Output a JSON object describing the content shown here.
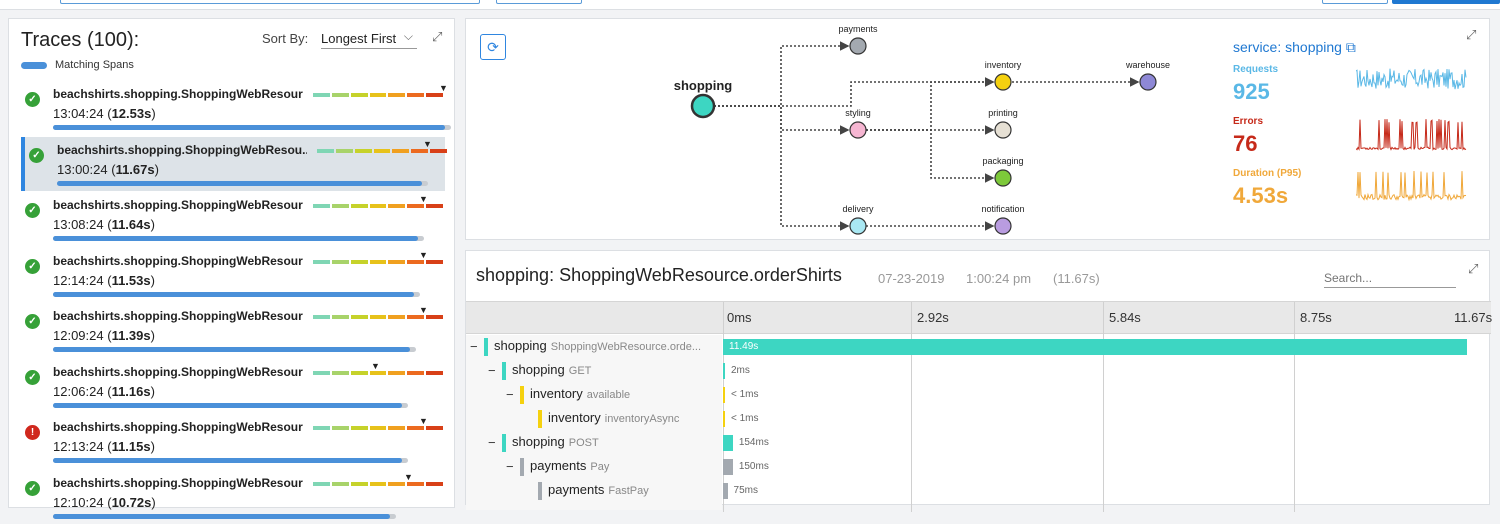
{
  "traces_panel": {
    "title": "Traces (100):",
    "sort_label": "Sort By:",
    "sort_value": "Longest First",
    "legend_label": "Matching Spans",
    "heat_colors": [
      "#7fd6b4",
      "#a8d36a",
      "#c6d22a",
      "#e7c21a",
      "#f0a020",
      "#ec6a20",
      "#d84018"
    ],
    "traces": [
      {
        "name": "beachshirts.shopping.ShoppingWebResource...",
        "time": "13:04:24",
        "duration": "12.53s",
        "status": "ok",
        "fraction": 1.0
      },
      {
        "name": "beachshirts.shopping.ShoppingWebResou...",
        "time": "13:00:24",
        "duration": "11.67s",
        "status": "ok",
        "fraction": 0.93,
        "selected": true
      },
      {
        "name": "beachshirts.shopping.ShoppingWebResource...",
        "time": "13:08:24",
        "duration": "11.64s",
        "status": "ok",
        "fraction": 0.93
      },
      {
        "name": "beachshirts.shopping.ShoppingWebResource...",
        "time": "12:14:24",
        "duration": "11.53s",
        "status": "ok",
        "fraction": 0.92
      },
      {
        "name": "beachshirts.shopping.ShoppingWebResource...",
        "time": "12:09:24",
        "duration": "11.39s",
        "status": "ok",
        "fraction": 0.91
      },
      {
        "name": "beachshirts.shopping.ShoppingWebResource...",
        "time": "12:06:24",
        "duration": "11.16s",
        "status": "ok",
        "fraction": 0.89
      },
      {
        "name": "beachshirts.shopping.ShoppingWebResource...",
        "time": "12:13:24",
        "duration": "11.15s",
        "status": "error",
        "fraction": 0.89
      },
      {
        "name": "beachshirts.shopping.ShoppingWebResource...",
        "time": "12:10:24",
        "duration": "10.72s",
        "status": "ok",
        "fraction": 0.86
      }
    ]
  },
  "service_map": {
    "nodes": [
      {
        "id": "shopping",
        "label": "shopping",
        "color": "#3dd6c2",
        "root": true
      },
      {
        "id": "payments",
        "label": "payments",
        "color": "#a3a9b0"
      },
      {
        "id": "styling",
        "label": "styling",
        "color": "#f6b6d2"
      },
      {
        "id": "delivery",
        "label": "delivery",
        "color": "#a9e8f3"
      },
      {
        "id": "inventory",
        "label": "inventory",
        "color": "#f5d10f"
      },
      {
        "id": "printing",
        "label": "printing",
        "color": "#e6e0d4"
      },
      {
        "id": "packaging",
        "label": "packaging",
        "color": "#7dc93a"
      },
      {
        "id": "notification",
        "label": "notification",
        "color": "#b99ce0"
      },
      {
        "id": "warehouse",
        "label": "warehouse",
        "color": "#8e88d6"
      }
    ],
    "service": {
      "title": "service: shopping",
      "requests_label": "Requests",
      "requests_value": "925",
      "requests_color": "#5ab8e6",
      "errors_label": "Errors",
      "errors_value": "76",
      "errors_color": "#c62a1a",
      "duration_label": "Duration (P95)",
      "duration_value": "4.53s",
      "duration_color": "#f0a83a"
    }
  },
  "trace_detail": {
    "title": "shopping: ShoppingWebResource.orderShirts",
    "date": "07-23-2019",
    "time": "1:00:24 pm",
    "duration": "(11.67s)",
    "search_placeholder": "Search...",
    "ticks": [
      "0ms",
      "2.92s",
      "5.84s",
      "8.75s",
      "11.67s"
    ],
    "spans": [
      {
        "service": "shopping",
        "operation": "ShoppingWebResource.orde...",
        "depth": 0,
        "color": "#3dd6c2",
        "duration_label": "11.49s",
        "fraction": 0.985
      },
      {
        "service": "shopping",
        "operation": "GET",
        "depth": 1,
        "color": "#3dd6c2",
        "duration_label": "2ms",
        "fraction": 0.002
      },
      {
        "service": "inventory",
        "operation": "available",
        "depth": 2,
        "color": "#f5d10f",
        "duration_label": "< 1ms",
        "fraction": 0.001
      },
      {
        "service": "inventory",
        "operation": "inventoryAsync",
        "depth": 3,
        "color": "#f5d10f",
        "duration_label": "< 1ms",
        "fraction": 0.001
      },
      {
        "service": "shopping",
        "operation": "POST",
        "depth": 1,
        "color": "#3dd6c2",
        "duration_label": "154ms",
        "fraction": 0.013
      },
      {
        "service": "payments",
        "operation": "Pay",
        "depth": 2,
        "color": "#a3a9b0",
        "duration_label": "150ms",
        "fraction": 0.013
      },
      {
        "service": "payments",
        "operation": "FastPay",
        "depth": 3,
        "color": "#a3a9b0",
        "duration_label": "75ms",
        "fraction": 0.006
      }
    ]
  }
}
